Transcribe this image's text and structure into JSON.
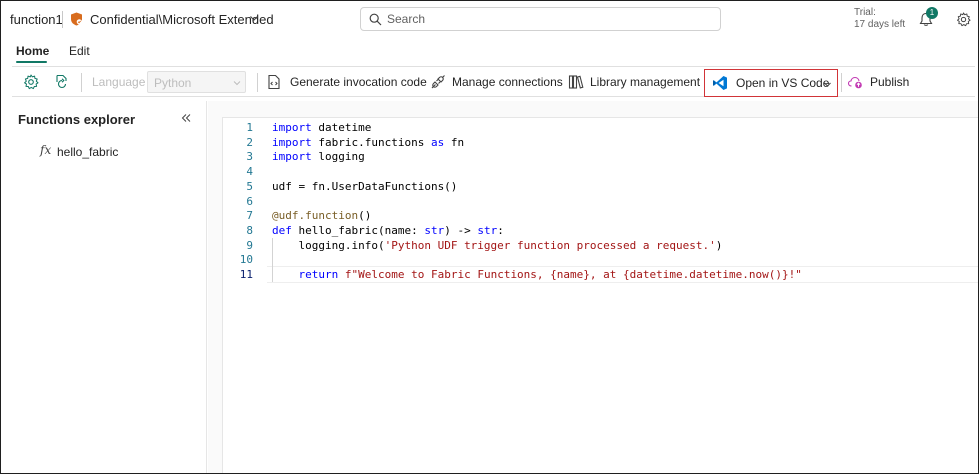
{
  "titlebar": {
    "app_name": "function1",
    "sensitivity_label": "Confidential\\Microsoft Extended",
    "search_placeholder": "Search",
    "trial_label": "Trial:",
    "trial_days": "17 days left",
    "notification_count": "1",
    "accent_color": "#117865"
  },
  "tabs": [
    {
      "label": "Home",
      "selected": true
    },
    {
      "label": "Edit",
      "selected": false
    }
  ],
  "toolbar": {
    "language_label": "Language",
    "language_value": "Python",
    "generate_invocation_label": "Generate invocation code",
    "manage_connections_label": "Manage connections",
    "library_management_label": "Library management",
    "open_vscode_label": "Open in VS Code",
    "publish_label": "Publish",
    "highlight_color": "#d13438"
  },
  "explorer": {
    "title": "Functions explorer",
    "items": [
      {
        "icon": "fx-icon",
        "label": "hello_fabric"
      }
    ]
  },
  "editor": {
    "language": "python",
    "active_line": 11,
    "lines": [
      {
        "no": "1",
        "text": "import datetime"
      },
      {
        "no": "2",
        "text": "import fabric.functions as fn"
      },
      {
        "no": "3",
        "text": "import logging"
      },
      {
        "no": "4",
        "text": ""
      },
      {
        "no": "5",
        "text": "udf = fn.UserDataFunctions()"
      },
      {
        "no": "6",
        "text": ""
      },
      {
        "no": "7",
        "text": "@udf.function()"
      },
      {
        "no": "8",
        "text": "def hello_fabric(name: str) -> str:"
      },
      {
        "no": "9",
        "text": "    logging.info('Python UDF trigger function processed a request.')"
      },
      {
        "no": "10",
        "text": ""
      },
      {
        "no": "11",
        "text": "    return f\"Welcome to Fabric Functions, {name}, at {datetime.datetime.now()}!\""
      }
    ]
  }
}
